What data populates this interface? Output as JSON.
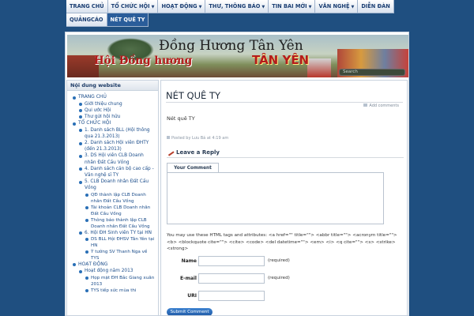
{
  "nav": {
    "items": [
      {
        "label": "TRANG CHỦ",
        "arrow": false
      },
      {
        "label": "TỔ CHỨC HỘI",
        "arrow": true
      },
      {
        "label": "HOẠT ĐỘNG",
        "arrow": true
      },
      {
        "label": "THƯ, THÔNG BÁO",
        "arrow": true
      },
      {
        "label": "TIN BAI MỚI",
        "arrow": true
      },
      {
        "label": "VĂN NGHỆ",
        "arrow": true
      },
      {
        "label": "DIỄN ĐÀN",
        "arrow": false
      },
      {
        "label": "QUẢNGCÁO",
        "arrow": false
      }
    ],
    "active_item": {
      "label": "NÉT QUÊ TY"
    }
  },
  "banner": {
    "title": "Đồng Hương Tân Yên",
    "subtitle_left": "Hội Đồng hương",
    "subtitle_right": "TÂN YÊN",
    "search_placeholder": "Search"
  },
  "sidebar": {
    "title": "Nội dung website",
    "items": [
      {
        "level": 0,
        "label": "TRANG CHỦ"
      },
      {
        "level": 1,
        "label": "Giới thiệu chung"
      },
      {
        "level": 1,
        "label": "Qui ước Hội"
      },
      {
        "level": 1,
        "label": "Thư gửi hội hữu"
      },
      {
        "level": 0,
        "label": "TỔ CHỨC HỘI"
      },
      {
        "level": 1,
        "label": "1. Danh sách BLL (Hội thông qua 21.3.2013)"
      },
      {
        "level": 1,
        "label": "2. Danh sách Hội viên ĐHTY (đến 21.3.2013)"
      },
      {
        "level": 1,
        "label": "3. DS Hội viên CLB Doanh nhân Đất Cầu Vồng"
      },
      {
        "level": 1,
        "label": "4. Danh sách cán bộ cao cấp - Văn nghệ sĩ TY"
      },
      {
        "level": 1,
        "label": "5. CLB Doanh nhân Đất Cầu Vồng"
      },
      {
        "level": 2,
        "label": "QĐ thành lập CLB Doanh nhân Đất Cầu Vồng"
      },
      {
        "level": 2,
        "label": "Tài khoản CLB Doanh nhân Đất Cầu Vồng"
      },
      {
        "level": 2,
        "label": "Thông báo thành lập CLB Doanh nhân Đất Cầu Vồng"
      },
      {
        "level": 1,
        "label": "6. Hội ĐH Sinh viên TY tại HN"
      },
      {
        "level": 2,
        "label": "DS BLL Hội ĐHSV Tân Yên tại HN"
      },
      {
        "level": 2,
        "label": "Ý tưởng SV Thanh Nga về TYS"
      },
      {
        "level": 0,
        "label": "HOẠT ĐỘNG"
      },
      {
        "level": 1,
        "label": "Hoạt động năm 2013"
      },
      {
        "level": 2,
        "label": "Họp mặt ĐH Bắc Giang xuân 2013"
      },
      {
        "level": 2,
        "label": "TYS tiếp sức mùa thi"
      }
    ]
  },
  "post": {
    "title": "NÉT QUÊ TY",
    "add_comments": "Add comments",
    "body": "Nét quê TY",
    "meta": "Posted by Lưu Bá at 4:19 am"
  },
  "comment_form": {
    "heading": "Leave a Reply",
    "tab_label": "Your Comment",
    "allowed_tags": "You may use these HTML tags and attributes: <a href=\"\" title=\"\"> <abbr title=\"\"> <acronym title=\"\"> <b> <blockquote cite=\"\"> <cite> <code> <del datetime=\"\"> <em> <i> <q cite=\"\"> <s> <strike> <strong>",
    "name_label": "Name",
    "email_label": "E-mail",
    "uri_label": "URI",
    "required_text": "(required)",
    "submit_label": "Submit Comment"
  },
  "colors": {
    "background": "#1f4f80",
    "nav_active": "#2a5d9a",
    "link": "#1a4c8a",
    "banner_accent": "#b51b1b",
    "submit": "#1f5aa6"
  }
}
